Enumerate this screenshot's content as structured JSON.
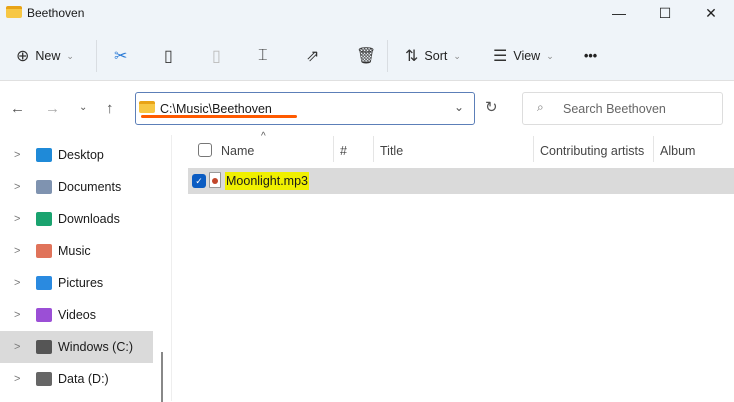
{
  "window": {
    "title": "Beethoven",
    "minimize": "—",
    "maximize": "☐",
    "close": "✕"
  },
  "toolbar": {
    "new": "New",
    "sort": "Sort",
    "view": "View",
    "more": "•••"
  },
  "address": {
    "path": "C:\\Music\\Beethoven",
    "search_placeholder": "Search Beethoven"
  },
  "sidebar": [
    {
      "label": "Desktop",
      "color": "#1f8ad8"
    },
    {
      "label": "Documents",
      "color": "#7f93b0"
    },
    {
      "label": "Downloads",
      "color": "#1aa36f"
    },
    {
      "label": "Music",
      "color": "#e0735a"
    },
    {
      "label": "Pictures",
      "color": "#2a8ae0"
    },
    {
      "label": "Videos",
      "color": "#9b4fd6"
    },
    {
      "label": "Windows (C:)",
      "color": "#555"
    },
    {
      "label": "Data (D:)",
      "color": "#666"
    }
  ],
  "columns": {
    "name": "Name",
    "number": "#",
    "title": "Title",
    "artists": "Contributing artists",
    "album": "Album"
  },
  "files": [
    {
      "name": "Moonlight.mp3",
      "selected": true
    }
  ],
  "colors": {
    "highlight": "#f0f000",
    "underline": "#ff5a00",
    "selection": "#dadada",
    "accent": "#0b5cc2"
  }
}
